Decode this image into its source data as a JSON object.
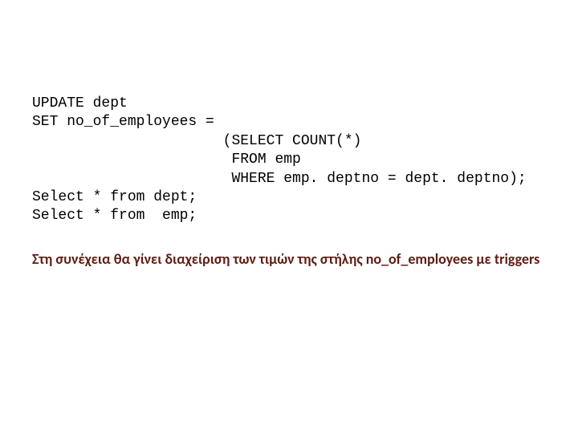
{
  "code": {
    "l1": "UPDATE dept",
    "l2": "SET no_of_employees =",
    "l3": "                      (SELECT COUNT(*)",
    "l4": "                       FROM emp",
    "l5": "                       WHERE emp. deptno = dept. deptno);",
    "l6": "Select * from dept;",
    "l7": "Select * from  emp;"
  },
  "note": "Στη συνέχεια θα γίνει διαχείριση των τιμών της στήλης no_of_employees με triggers"
}
